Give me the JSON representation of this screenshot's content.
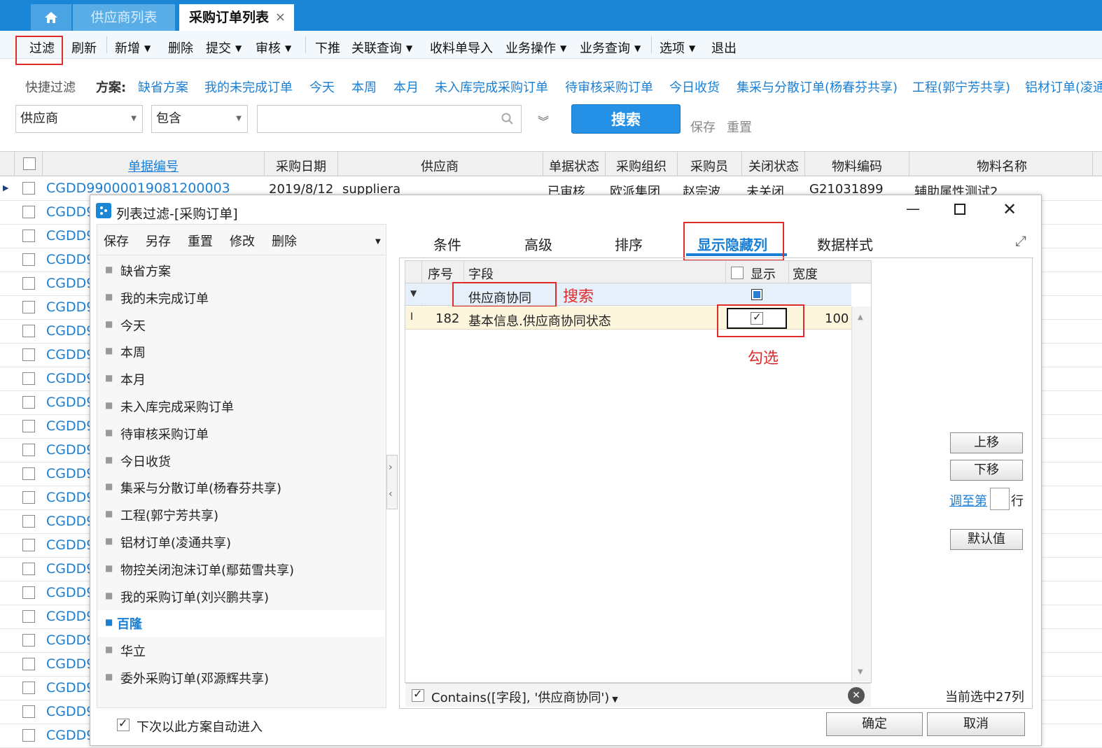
{
  "tabs": {
    "home_icon": "home-icon",
    "supplier_list": "供应商列表",
    "po_list": "采购订单列表",
    "close": "×"
  },
  "toolbar": {
    "filter": "过滤",
    "refresh": "刷新",
    "add": "新增",
    "delete": "删除",
    "submit": "提交",
    "audit": "审核",
    "push_down": "下推",
    "related_query": "关联查询",
    "receipt_import": "收料单导入",
    "biz_ops": "业务操作",
    "biz_query": "业务查询",
    "options": "选项",
    "exit": "退出"
  },
  "quick_filter": {
    "label": "快捷过滤",
    "scheme_label": "方案:",
    "schemes": [
      "缺省方案",
      "我的未完成订单",
      "今天",
      "本周",
      "本月",
      "未入库完成采购订单",
      "待审核采购订单",
      "今日收货",
      "集采与分散订单(杨春芬共享)",
      "工程(郭宁芳共享)",
      "铝材订单(凌通"
    ]
  },
  "search": {
    "field": "供应商",
    "op": "包含",
    "value": "",
    "button": "搜索",
    "save": "保存",
    "reset": "重置"
  },
  "grid": {
    "headers": [
      "单据编号",
      "采购日期",
      "供应商",
      "单据状态",
      "采购组织",
      "采购员",
      "关闭状态",
      "物料编码",
      "物料名称"
    ],
    "first_row": {
      "code": "CGDD99000019081200003",
      "date": "2019/8/12",
      "supplier": "suppliera",
      "status": "已审核",
      "org": "欧派集团",
      "buyer": "赵宗波",
      "close": "未关闭",
      "material_code": "G21031899",
      "material_name": "辅助属性测试2"
    },
    "row_prefix": "CGDD9"
  },
  "dialog": {
    "title": "列表过滤-[采购订单]",
    "left_toolbar": [
      "保存",
      "另存",
      "重置",
      "修改",
      "删除"
    ],
    "schemes": [
      "缺省方案",
      "我的未完成订单",
      "今天",
      "本周",
      "本月",
      "未入库完成采购订单",
      "待审核采购订单",
      "今日收货",
      "集采与分散订单(杨春芬共享)",
      "工程(郭宁芳共享)",
      "铝材订单(凌通共享)",
      "物控关闭泡沫订单(鄢茹雪共享)",
      "我的采购订单(刘兴鹏共享)",
      "百隆",
      "华立",
      "委外采购订单(邓源辉共享)"
    ],
    "selected_scheme": "百隆",
    "auto_enter": "下次以此方案自动进入",
    "tabs": [
      "条件",
      "高级",
      "排序",
      "显示隐藏列",
      "数据样式"
    ],
    "active_tab": "显示隐藏列",
    "field_grid": {
      "headers": {
        "seq": "序号",
        "field": "字段",
        "show": "显示",
        "width": "宽度"
      },
      "filter_row_value": "供应商协同",
      "rows": [
        {
          "seq": "182",
          "field": "基本信息.供应商协同状态",
          "show": true,
          "width": "100"
        }
      ],
      "filter_expr": "Contains([字段], '供应商协同')"
    },
    "buttons": {
      "up": "上移",
      "down": "下移",
      "goto": "调至第",
      "goto_suffix": "行",
      "default": "默认值",
      "ok": "确定",
      "cancel": "取消"
    },
    "selected_count": "当前选中27列"
  },
  "annotations": {
    "search": "搜索",
    "check": "勾选"
  },
  "colors": {
    "brand": "#1b86d6",
    "link": "#1a7fd4",
    "annotation": "#e02b2b"
  }
}
